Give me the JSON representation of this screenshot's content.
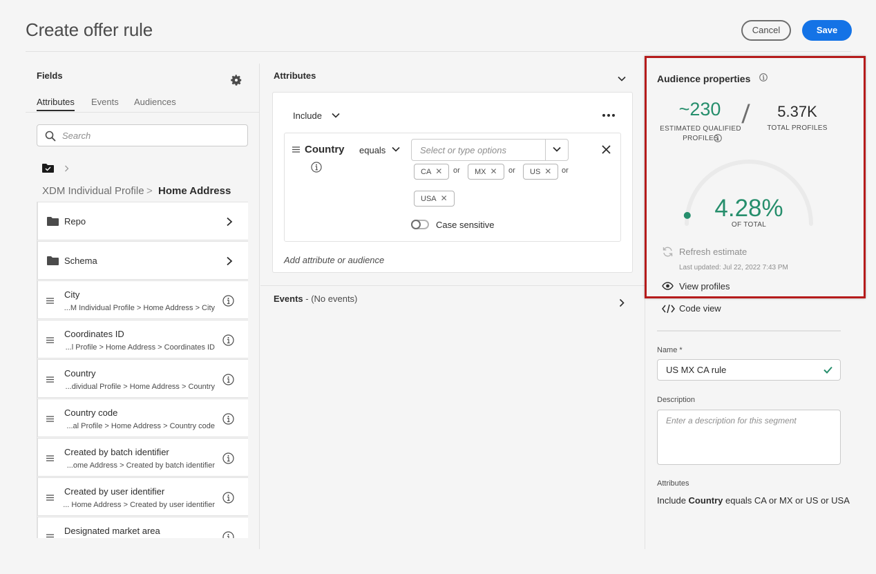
{
  "page": {
    "title": "Create offer rule"
  },
  "header": {
    "cancel_label": "Cancel",
    "save_label": "Save"
  },
  "fields_panel": {
    "title": "Fields",
    "tabs": [
      {
        "label": "Attributes",
        "active": true
      },
      {
        "label": "Events",
        "active": false
      },
      {
        "label": "Audiences",
        "active": false
      }
    ],
    "search_placeholder": "Search",
    "breadcrumb": {
      "parent": "XDM Individual Profile",
      "separator": ">",
      "current": "Home Address"
    },
    "folders": [
      {
        "name": "Repo"
      },
      {
        "name": "Schema"
      }
    ],
    "fields": [
      {
        "name": "City",
        "path": "...M Individual Profile > Home Address > City"
      },
      {
        "name": "Coordinates ID",
        "path": "...l Profile > Home Address > Coordinates ID"
      },
      {
        "name": "Country",
        "path": "...dividual Profile > Home Address > Country"
      },
      {
        "name": "Country code",
        "path": "...al Profile > Home Address > Country code"
      },
      {
        "name": "Created by batch identifier",
        "path": "...ome Address > Created by batch identifier"
      },
      {
        "name": "Created by user identifier",
        "path": "... Home Address > Created by user identifier"
      },
      {
        "name": "Designated market area",
        "path": ""
      }
    ]
  },
  "rule_panel": {
    "attributes_title": "Attributes",
    "include_label": "Include",
    "condition": {
      "attribute": "Country",
      "operator": "equals",
      "combo_placeholder": "Select or type options",
      "values": [
        "CA",
        "MX",
        "US",
        "USA"
      ],
      "or_label": "or",
      "case_sensitive_label": "Case sensitive",
      "case_sensitive": false
    },
    "add_placeholder": "Add attribute or audience",
    "events_title": "Events",
    "events_note": " - (No events)"
  },
  "audience": {
    "title": "Audience properties",
    "estimated_value": "~230",
    "estimated_label": "ESTIMATED QUALIFIED PROFILES",
    "total_value": "5.37K",
    "total_label": "TOTAL PROFILES",
    "percent_value": "4.28%",
    "percent_fraction": 0.0428,
    "percent_label": "OF TOTAL",
    "refresh_label": "Refresh estimate",
    "last_updated": "Last updated: Jul 22, 2022 7:43 PM",
    "view_profiles_label": "View profiles",
    "code_view_label": "Code view",
    "name_label": "Name *",
    "name_value": "US MX CA rule",
    "description_label": "Description",
    "description_placeholder": "Enter a description for this segment",
    "attributes_label": "Attributes",
    "summary": {
      "prefix": "Include ",
      "attribute": "Country",
      "rest": " equals CA or MX or US or USA"
    }
  },
  "colors": {
    "accent": "#1473e6",
    "positive": "#268e6c",
    "highlight": "#b51b1b"
  }
}
